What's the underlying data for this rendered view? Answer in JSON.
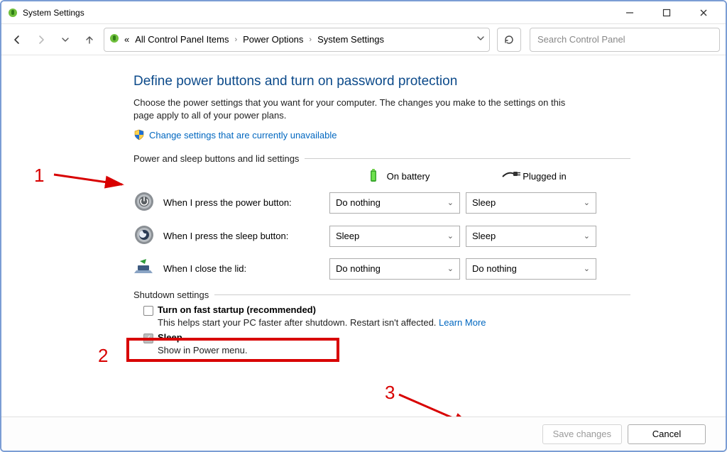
{
  "window": {
    "title": "System Settings"
  },
  "breadcrumbs": {
    "leading": "«",
    "items": [
      "All Control Panel Items",
      "Power Options",
      "System Settings"
    ]
  },
  "search": {
    "placeholder": "Search Control Panel"
  },
  "page": {
    "heading": "Define power buttons and turn on password protection",
    "description": "Choose the power settings that you want for your computer. The changes you make to the settings on this page apply to all of your power plans.",
    "change_link": "Change settings that are currently unavailable"
  },
  "section_power": {
    "label": "Power and sleep buttons and lid settings",
    "col_battery": "On battery",
    "col_plugged": "Plugged in",
    "rows": [
      {
        "label": "When I press the power button:",
        "battery": "Do nothing",
        "plugged": "Sleep"
      },
      {
        "label": "When I press the sleep button:",
        "battery": "Sleep",
        "plugged": "Sleep"
      },
      {
        "label": "When I close the lid:",
        "battery": "Do nothing",
        "plugged": "Do nothing"
      }
    ]
  },
  "section_shutdown": {
    "label": "Shutdown settings",
    "fast_startup": {
      "label": "Turn on fast startup (recommended)",
      "checked": false,
      "help": "This helps start your PC faster after shutdown. Restart isn't affected. ",
      "learn_more": "Learn More"
    },
    "sleep": {
      "label": "Sleep",
      "checked": true,
      "help": "Show in Power menu."
    }
  },
  "buttons": {
    "save": "Save changes",
    "cancel": "Cancel"
  },
  "annotations": {
    "n1": "1",
    "n2": "2",
    "n3": "3"
  }
}
